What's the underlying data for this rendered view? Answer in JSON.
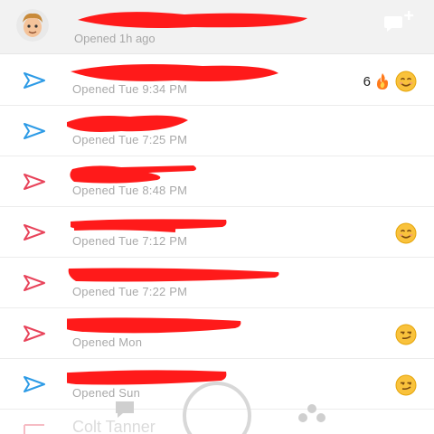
{
  "header": {
    "subtitle": "Opened 1h ago",
    "new_chat_icon": "new-chat-icon"
  },
  "colors": {
    "sent_blue": "#2d9be6",
    "sent_red": "#e8435a",
    "redaction": "#ff1a1a"
  },
  "chats": [
    {
      "status": "Opened Tue 9:34 PM",
      "arrow": "blue",
      "streak": "6",
      "emojis": [
        "fire",
        "smile"
      ]
    },
    {
      "status": "Opened Tue 7:25 PM",
      "arrow": "blue"
    },
    {
      "status": "Opened Tue 8:48 PM",
      "arrow": "red"
    },
    {
      "status": "Opened Tue 7:12 PM",
      "arrow": "red",
      "emojis": [
        "smile"
      ]
    },
    {
      "status": "Opened Tue 7:22 PM",
      "arrow": "red"
    },
    {
      "status": "Opened Mon",
      "arrow": "red",
      "emojis": [
        "smirk"
      ]
    },
    {
      "status": "Opened Sun",
      "arrow": "blue",
      "emojis": [
        "smirk"
      ]
    }
  ],
  "ghost_row": {
    "name": "Colt Tanner"
  }
}
